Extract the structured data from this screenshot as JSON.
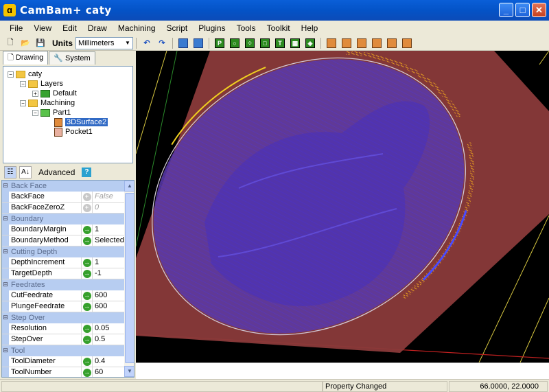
{
  "window": {
    "title": "CamBam+  caty",
    "app_icon": "cambam-logo-icon"
  },
  "menu": [
    "File",
    "View",
    "Edit",
    "Draw",
    "Machining",
    "Script",
    "Plugins",
    "Tools",
    "Toolkit",
    "Help"
  ],
  "toolbar": {
    "units_label": "Units",
    "units_value": "Millimeters"
  },
  "tabs": {
    "drawing": "Drawing",
    "system": "System"
  },
  "tree": {
    "root": "caty",
    "layers": "Layers",
    "default_layer": "Default",
    "machining": "Machining",
    "part": "Part1",
    "op1": "3DSurface2",
    "op2": "Pocket1"
  },
  "props_toolbar": {
    "advanced": "Advanced",
    "help": "?"
  },
  "properties": {
    "cat_backface": "Back Face",
    "backface_name": "BackFace",
    "backface_value": "False",
    "backfacezeroz_name": "BackFaceZeroZ",
    "backfacezeroz_value": "0",
    "cat_boundary": "Boundary",
    "boundarymargin_name": "BoundaryMargin",
    "boundarymargin_value": "1",
    "boundarymethod_name": "BoundaryMethod",
    "boundarymethod_value": "Selected",
    "cat_cutting": "Cutting Depth",
    "depthincrement_name": "DepthIncrement",
    "depthincrement_value": "1",
    "targetdepth_name": "TargetDepth",
    "targetdepth_value": "-1",
    "cat_feedrates": "Feedrates",
    "cutfeedrate_name": "CutFeedrate",
    "cutfeedrate_value": "600",
    "plungefeedrate_name": "PlungeFeedrate",
    "plungefeedrate_value": "600",
    "cat_stepover": "Step Over",
    "resolution_name": "Resolution",
    "resolution_value": "0.05",
    "stepover_name": "StepOver",
    "stepover_value": "0.5",
    "cat_tool": "Tool",
    "tooldiameter_name": "ToolDiameter",
    "tooldiameter_value": "0.4",
    "toolnumber_name": "ToolNumber",
    "toolnumber_value": "60"
  },
  "status": {
    "message": "Property Changed",
    "coords": "66.0000, 22.0000"
  },
  "colors": {
    "surface": "#8a2a2a",
    "toolpath": "#3a2ad0",
    "boundary": "#c8c8c8",
    "accent": "#f0d020"
  }
}
